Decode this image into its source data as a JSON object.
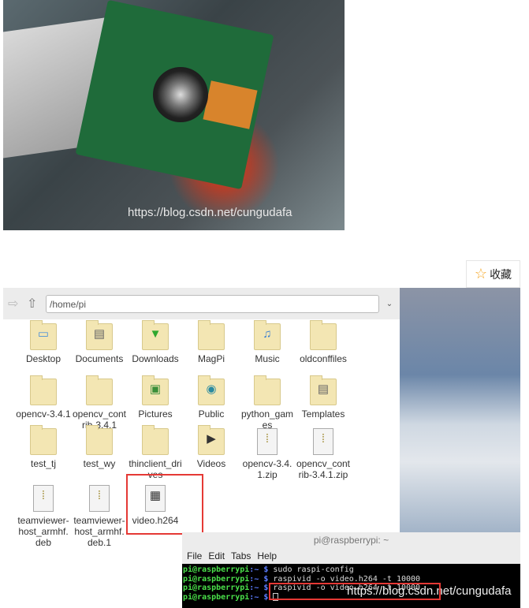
{
  "photo": {
    "watermark": "https://blog.csdn.net/cungudafa"
  },
  "favorite": {
    "label": "收藏",
    "icon": "star-icon"
  },
  "file_manager": {
    "path": "/home/pi",
    "items": [
      {
        "label": "Desktop",
        "type": "desktop"
      },
      {
        "label": "Documents",
        "type": "documents"
      },
      {
        "label": "Downloads",
        "type": "downloads"
      },
      {
        "label": "MagPi",
        "type": "folder"
      },
      {
        "label": "Music",
        "type": "music"
      },
      {
        "label": "oldconffiles",
        "type": "folder"
      },
      {
        "label": "opencv-3.4.1",
        "type": "folder"
      },
      {
        "label": "opencv_contrib-3.4.1",
        "type": "folder"
      },
      {
        "label": "Pictures",
        "type": "pictures"
      },
      {
        "label": "Public",
        "type": "public"
      },
      {
        "label": "python_games",
        "type": "folder"
      },
      {
        "label": "Templates",
        "type": "templates"
      },
      {
        "label": "test_tj",
        "type": "folder"
      },
      {
        "label": "test_wy",
        "type": "folder"
      },
      {
        "label": "thinclient_drives",
        "type": "folder"
      },
      {
        "label": "Videos",
        "type": "videos"
      },
      {
        "label": "opencv-3.4.1.zip",
        "type": "zip"
      },
      {
        "label": "opencv_contrib-3.4.1.zip",
        "type": "zip"
      },
      {
        "label": "teamviewer-host_armhf.deb",
        "type": "zip"
      },
      {
        "label": "teamviewer-host_armhf.deb.1",
        "type": "zip"
      },
      {
        "label": "video.h264",
        "type": "video"
      }
    ]
  },
  "terminal": {
    "title": "pi@raspberrypi: ~",
    "menu": [
      "File",
      "Edit",
      "Tabs",
      "Help"
    ],
    "prompt": "pi@raspberrypi",
    "lines": [
      "sudo raspi-config",
      "raspivid -o video.h264 -t 10000",
      "raspivid -o video.h264 -t 10000",
      ""
    ],
    "watermark": "https://blog.csdn.net/cungudafa"
  },
  "colors": {
    "highlight": "#e53935",
    "prompt": "#4ae04a"
  }
}
